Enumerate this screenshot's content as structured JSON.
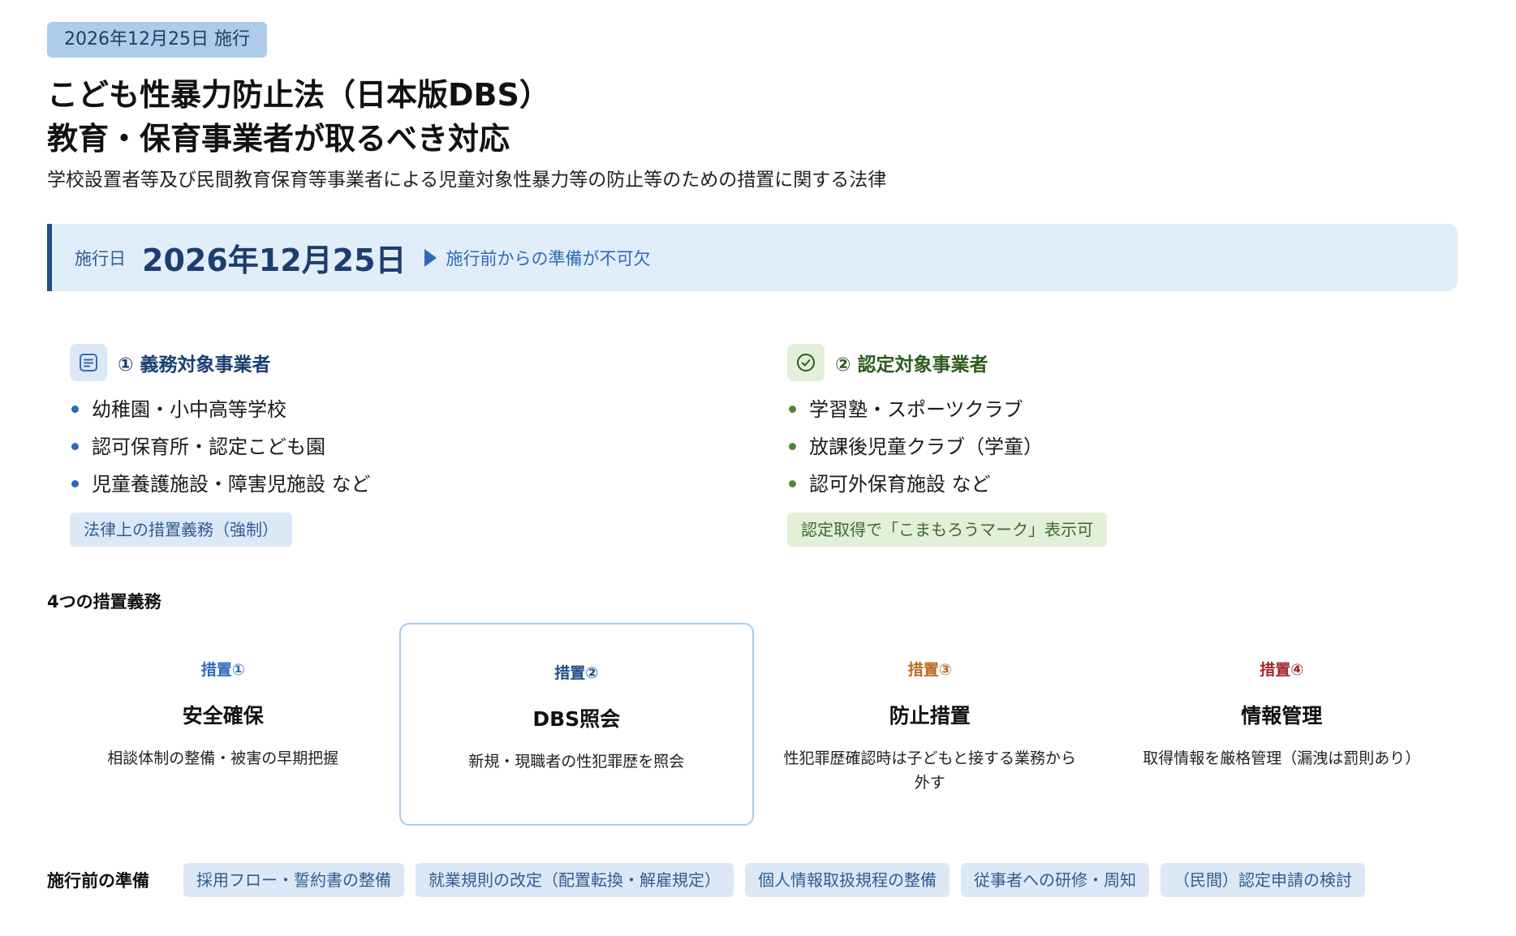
{
  "header": {
    "effective_tag": "2026年12月25日 施行",
    "title_line1": "こども性暴力防止法（日本版DBS）",
    "title_line2": "教育・保育事業者が取るべき対応",
    "subtitle": "学校設置者等及び民間教育保育等事業者による児童対象性暴力等の防止等のための措置に関する法律"
  },
  "banner": {
    "label": "施行日",
    "date": "2026年12月25日",
    "note": "施行前からの準備が不可欠"
  },
  "categories": [
    {
      "title": "① 義務対象事業者",
      "icon": "document-list-icon",
      "color": "#2f6ab8",
      "items": [
        "幼稚園・小中高等学校",
        "認可保育所・認定こども園",
        "児童養護施設・障害児施設 など"
      ],
      "badge": "法律上の措置義務（強制）"
    },
    {
      "title": "② 認定対象事業者",
      "icon": "check-circle-icon",
      "color": "#4e8a36",
      "items": [
        "学習塾・スポーツクラブ",
        "放課後児童クラブ（学童）",
        "認可外保育施設 など"
      ],
      "badge": "認定取得で「こまもろうマーク」表示可"
    }
  ],
  "measures_section": {
    "label": "4つの措置義務",
    "items": [
      {
        "no": "措置①",
        "name": "安全確保",
        "desc": "相談体制の整備・被害の早期把握",
        "color": "#2f6ab8"
      },
      {
        "no": "措置②",
        "name": "DBS照会",
        "desc": "新規・現職者の性犯罪歴を照会",
        "color": "#1f4e8a"
      },
      {
        "no": "措置③",
        "name": "防止措置",
        "desc": "性犯罪歴確認時は子どもと接する業務から外す",
        "color": "#b86a1f"
      },
      {
        "no": "措置④",
        "name": "情報管理",
        "desc": "取得情報を厳格管理（漏洩は罰則あり）",
        "color": "#a3262a"
      }
    ]
  },
  "preparation": {
    "label": "施行前の準備",
    "chips": [
      "採用フロー・誓約書の整備",
      "就業規則の改定（配置転換・解雇規定）",
      "個人情報取扱規程の整備",
      "従事者への研修・周知",
      "（民間）認定申請の検討"
    ]
  }
}
